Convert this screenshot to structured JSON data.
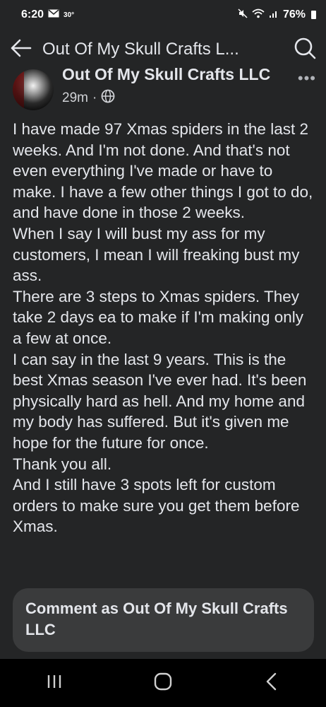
{
  "status_bar": {
    "time": "6:20",
    "temp": "30°",
    "battery": "76%",
    "icons": [
      "mail-icon",
      "mute-icon",
      "wifi-icon",
      "signal-icon",
      "battery-icon"
    ]
  },
  "header": {
    "title": "Out Of My Skull Crafts L...",
    "back_icon": "arrow-left-icon",
    "search_icon": "search-icon"
  },
  "post": {
    "author": "Out Of My Skull Crafts LLC",
    "time": "29m",
    "separator": "·",
    "privacy_icon": "globe-icon",
    "more_label": "•••",
    "paragraphs": [
      "I have made 97 Xmas spiders in the last 2 weeks. And I'm not done. And that's not even everything I've made or have to make. I have a few other things I got to do, and have done in those 2 weeks.",
      "When I say I will bust my ass for my customers,  I mean I will freaking bust my ass.",
      "There are 3 steps to Xmas spiders. They take 2 days ea to make if I'm making only a few at once.",
      "I can say in the last 9 years. This is the best Xmas season I've ever had. It's been physically hard as hell. And my home and my body has suffered. But it's given me hope for the future for once.",
      "Thank you all.",
      "And I still have 3 spots left for custom orders to make sure you get them before Xmas."
    ]
  },
  "comment": {
    "placeholder": "Comment as Out Of My Skull Crafts LLC"
  },
  "nav_bar": {
    "items": [
      "recents-icon",
      "home-icon",
      "back-icon"
    ]
  }
}
